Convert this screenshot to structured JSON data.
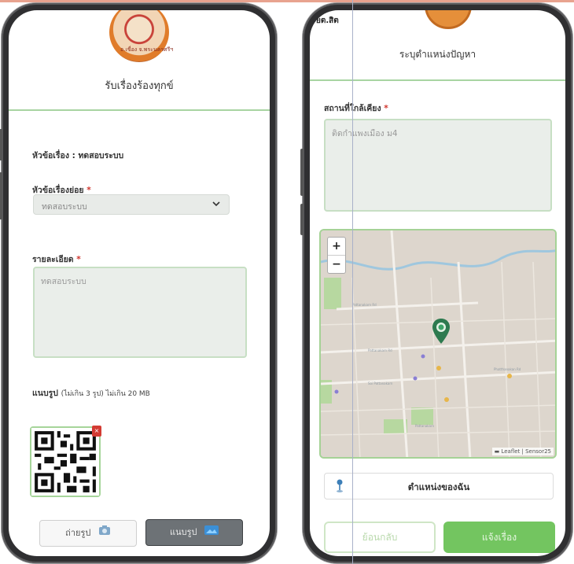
{
  "left_screen": {
    "logo_text": "อ.เขื่อง จ.พระนครศรีฯ",
    "title": "รับเรื่องร้องทุกข์",
    "subject_line": "หัวข้อเรื่อง : ทดสอบระบบ",
    "subtopic_label": "หัวข้อเรื่องย่อย",
    "required_mark": "*",
    "subtopic_value": "ทดสอบระบบ",
    "detail_label": "รายละเอียด",
    "detail_value": "ทดสอบระบบ",
    "attach_label": "แนบรูป",
    "attach_note": "(ไม่เกิน 3 รูป) ไม่เกิน 20 MB",
    "remove_icon_text": "×",
    "take_photo_button": "ถ่ายรูป",
    "attach_button": "แนบรูป"
  },
  "right_screen": {
    "cut_text": "ยต.สิต",
    "title": "ระบุตำแหน่งปัญหา",
    "nearby_label": "สถานที่ใกล้เคียง",
    "required_mark": "*",
    "nearby_value": "ติดกำแพงเมือง ม4",
    "map": {
      "zoom_in": "+",
      "zoom_out": "−",
      "attribution": "▬ Leaflet | Sensor25"
    },
    "my_location_button": "ตำแหน่งของฉัน",
    "back_button": "ย้อนกลับ",
    "report_button": "แจ้งเรื่อง"
  },
  "colors": {
    "accent_green": "#73c560",
    "required_red": "#d0342c",
    "map_pin": "#2d7a4f"
  }
}
